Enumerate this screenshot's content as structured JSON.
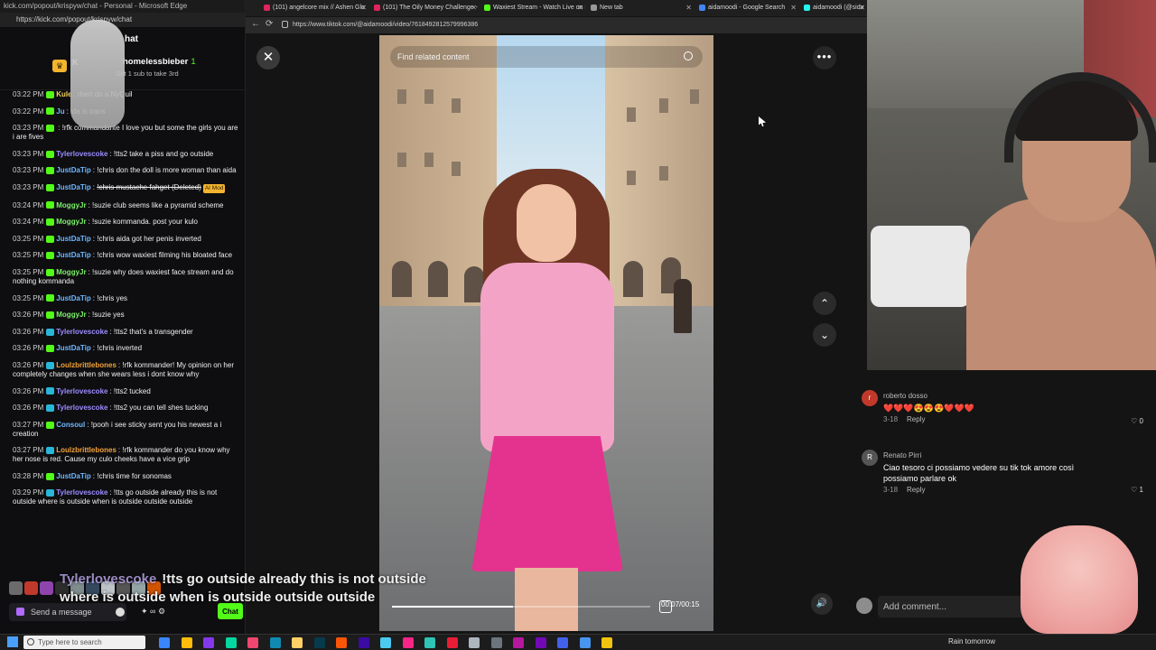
{
  "chat_window": {
    "title": "kick.com/popout/krispyw/chat - Personal - Microsoft Edge",
    "url": "https://kick.com/popout/krispyw/chat",
    "header_title": "hat",
    "gift": {
      "k_label": "K",
      "user": "homelessbieber",
      "count": "1",
      "subtitle": "Gift 1 sub to take 3rd"
    },
    "messages": [
      {
        "ts": "03:22 PM",
        "badge_color": "#53fc18",
        "user": "Kule",
        "user_color": "#f3d25a",
        "text": "rbert do a NyQuil",
        "strike": false,
        "mod": ""
      },
      {
        "ts": "03:22 PM",
        "badge_color": "#53fc18",
        "user": "Ju",
        "user_color": "#6fb7ff",
        "text": "ida is trans",
        "strike": false,
        "mod": ""
      },
      {
        "ts": "03:23 PM",
        "badge_color": "#53fc18",
        "user": "",
        "user_color": "#f3d25a",
        "text": "!rfk commandante I love you but some the girls you are i are fives",
        "strike": false,
        "mod": ""
      },
      {
        "ts": "03:23 PM",
        "badge_color": "#53fc18",
        "user": "Tylerlovescoke",
        "user_color": "#9b8cff",
        "text": "!tts2 take a piss and go outside",
        "strike": false,
        "mod": ""
      },
      {
        "ts": "03:23 PM",
        "badge_color": "#53fc18",
        "user": "JustDaTip",
        "user_color": "#6fb7ff",
        "text": "!chris don the doll is more woman than aida",
        "strike": false,
        "mod": ""
      },
      {
        "ts": "03:23 PM",
        "badge_color": "#53fc18",
        "user": "JustDaTip",
        "user_color": "#6fb7ff",
        "text": "!chris mustache fahget (Deleted)",
        "strike": true,
        "mod": "AI Mod"
      },
      {
        "ts": "03:24 PM",
        "badge_color": "#53fc18",
        "user": "MoggyJr",
        "user_color": "#7df06a",
        "text": "!suzie club seems like a pyramid scheme",
        "strike": false,
        "mod": ""
      },
      {
        "ts": "03:24 PM",
        "badge_color": "#53fc18",
        "user": "MoggyJr",
        "user_color": "#7df06a",
        "text": "!suzie kommanda. post your kulo",
        "strike": false,
        "mod": ""
      },
      {
        "ts": "03:25 PM",
        "badge_color": "#53fc18",
        "user": "JustDaTip",
        "user_color": "#6fb7ff",
        "text": "!chris aida got her penis inverted",
        "strike": false,
        "mod": ""
      },
      {
        "ts": "03:25 PM",
        "badge_color": "#53fc18",
        "user": "JustDaTip",
        "user_color": "#6fb7ff",
        "text": "!chris wow waxiest filming his bloated face",
        "strike": false,
        "mod": ""
      },
      {
        "ts": "03:25 PM",
        "badge_color": "#53fc18",
        "user": "MoggyJr",
        "user_color": "#7df06a",
        "text": "!suzie why does waxiest face stream and do nothing kommanda",
        "strike": false,
        "mod": ""
      },
      {
        "ts": "03:25 PM",
        "badge_color": "#53fc18",
        "user": "JustDaTip",
        "user_color": "#6fb7ff",
        "text": "!chris yes",
        "strike": false,
        "mod": ""
      },
      {
        "ts": "03:26 PM",
        "badge_color": "#53fc18",
        "user": "MoggyJr",
        "user_color": "#7df06a",
        "text": "!suzie yes",
        "strike": false,
        "mod": ""
      },
      {
        "ts": "03:26 PM",
        "badge_color": "#29b6d8",
        "user": "Tylerlovescoke",
        "user_color": "#9b8cff",
        "text": "!tts2 that's a transgender",
        "strike": false,
        "mod": ""
      },
      {
        "ts": "03:26 PM",
        "badge_color": "#53fc18",
        "user": "JustDaTip",
        "user_color": "#6fb7ff",
        "text": "!chris inverted",
        "strike": false,
        "mod": ""
      },
      {
        "ts": "03:26 PM",
        "badge_color": "#29b6d8",
        "user": "Loulzbrittlebones",
        "user_color": "#f3a23a",
        "text": "!rfk kommander! My opinion on her completely changes when she wears less i dont know why",
        "strike": false,
        "mod": ""
      },
      {
        "ts": "03:26 PM",
        "badge_color": "#29b6d8",
        "user": "Tylerlovescoke",
        "user_color": "#9b8cff",
        "text": "!tts2 tucked",
        "strike": false,
        "mod": ""
      },
      {
        "ts": "03:26 PM",
        "badge_color": "#29b6d8",
        "user": "Tylerlovescoke",
        "user_color": "#9b8cff",
        "text": "!tts2 you can tell shes tucking",
        "strike": false,
        "mod": ""
      },
      {
        "ts": "03:27 PM",
        "badge_color": "#53fc18",
        "user": "Consoul",
        "user_color": "#6fb7ff",
        "text": "!pooh i see sticky sent you his newest a i creation",
        "strike": false,
        "mod": ""
      },
      {
        "ts": "03:27 PM",
        "badge_color": "#29b6d8",
        "user": "Loulzbrittlebones",
        "user_color": "#f3a23a",
        "text": "!rfk kommander do you know why her nose is red. Cause my culo cheeks have a vice grip",
        "strike": false,
        "mod": ""
      },
      {
        "ts": "03:28 PM",
        "badge_color": "#53fc18",
        "user": "JustDaTip",
        "user_color": "#6fb7ff",
        "text": "!chris time for sonomas",
        "strike": false,
        "mod": ""
      },
      {
        "ts": "03:29 PM",
        "badge_color": "#29b6d8",
        "user": "Tylerlovescoke",
        "user_color": "#9b8cff",
        "text": "!tts go outside already this is not outside where is outside when is outside outside outside",
        "strike": false,
        "mod": ""
      }
    ],
    "emote_colors": [
      "#6b6b6b",
      "#c0392b",
      "#8e44ad",
      "#2d2d2d",
      "#7f8c8d",
      "#34495e",
      "#bdc3c7",
      "#555",
      "#95a5a6",
      "#d35400"
    ],
    "input_placeholder": "Send a message",
    "tools_label": "✦ ∞ ⚙",
    "send_label": "Chat"
  },
  "browser": {
    "tabs": [
      {
        "label": "(101) angelcore mix // Ashen Glo",
        "color": "#e0245e"
      },
      {
        "label": "(101) The Oily Money Challenge -",
        "color": "#e0245e"
      },
      {
        "label": "Waxiest Stream - Watch Live on K",
        "color": "#53fc18"
      },
      {
        "label": "New tab",
        "color": "#999999"
      },
      {
        "label": "aidamoodi - Google Search",
        "color": "#4285f4"
      },
      {
        "label": "aidamoodi (@sida",
        "color": "#25f4ee"
      }
    ],
    "url": "https://www.tiktok.com/@aidamoodi/video/7618492812579996386",
    "viewer": {
      "search_placeholder": "Find related content",
      "time": "00:07/00:15",
      "progress": 0.47,
      "close_icon": "✕",
      "more_icon": "•••",
      "up_icon": "⌃",
      "down_icon": "⌄",
      "volume_icon": "🔊"
    }
  },
  "comments": [
    {
      "avatar": "r",
      "avatar_color": "#c0392b",
      "user": "roberto dosso",
      "text": "❤️❤️❤️😍😍😍❤️❤️❤️",
      "date": "3-18",
      "reply": "Reply",
      "likes": "0"
    },
    {
      "avatar": "R",
      "avatar_color": "#555555",
      "user": "Renato Pirri",
      "text": "Ciao tesoro ci possiamo vedere su tik tok amore così possiamo parlare ok",
      "date": "3-18",
      "reply": "Reply",
      "likes": "1"
    }
  ],
  "comment_placeholder": "Add comment...",
  "overlay_caption": {
    "user": "Tylerlovescoke",
    "text": "!tts go outside already this is not outside where is outside when is outside outside outside"
  },
  "taskbar": {
    "search_placeholder": "Type here to search",
    "weather": "Rain tomorrow",
    "icon_colors": [
      "#3a86ff",
      "#ffbe0b",
      "#8338ec",
      "#06d6a0",
      "#ef476f",
      "#118ab2",
      "#ffd166",
      "#073b4c",
      "#fb5607",
      "#3a0ca3",
      "#4cc9f0",
      "#f72585",
      "#2ec4b6",
      "#e71d36",
      "#adb5bd",
      "#6c757d",
      "#b5179e",
      "#7209b7",
      "#4361ee",
      "#4895ef",
      "#f1c40f"
    ]
  }
}
